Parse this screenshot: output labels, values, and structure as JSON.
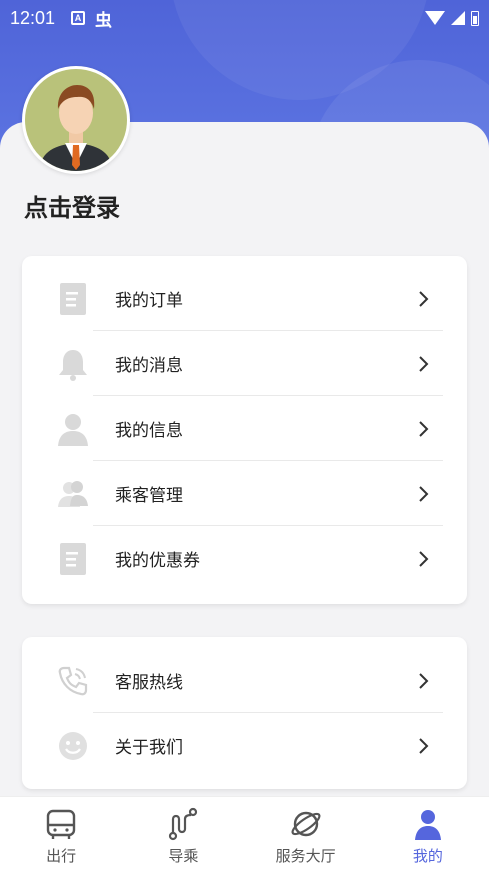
{
  "status_bar": {
    "time": "12:01"
  },
  "profile": {
    "login_text": "点击登录"
  },
  "menu_group_1": [
    {
      "label": "我的订单",
      "icon": "document-icon"
    },
    {
      "label": "我的消息",
      "icon": "bell-icon"
    },
    {
      "label": "我的信息",
      "icon": "person-icon"
    },
    {
      "label": "乘客管理",
      "icon": "group-icon"
    },
    {
      "label": "我的优惠券",
      "icon": "coupon-icon"
    }
  ],
  "menu_group_2": [
    {
      "label": "客服热线",
      "icon": "phone-icon"
    },
    {
      "label": "关于我们",
      "icon": "smile-icon"
    }
  ],
  "tabbar": [
    {
      "label": "出行",
      "icon": "bus-icon"
    },
    {
      "label": "导乘",
      "icon": "route-icon"
    },
    {
      "label": "服务大厅",
      "icon": "planet-icon"
    },
    {
      "label": "我的",
      "icon": "user-icon",
      "active": true
    }
  ],
  "colors": {
    "accent": "#5566dd",
    "header": "#4f64d8",
    "icon_gray": "#d8d8d8"
  }
}
